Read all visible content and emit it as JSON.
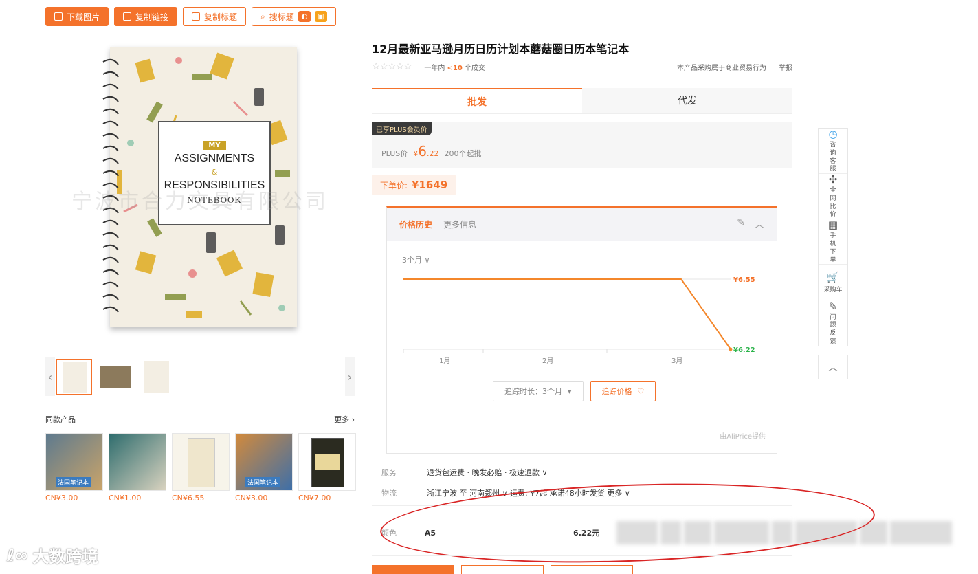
{
  "toolbar": {
    "download_image": "下载图片",
    "copy_link": "复制链接",
    "copy_title": "复制标题",
    "search_title": "搜标题"
  },
  "product": {
    "title": "12月最新亚马逊月历日历计划本蘑菇圈日历本笔记本",
    "stars": "☆☆☆☆☆",
    "sales_prefix": "一年内",
    "sales_count": "<10",
    "sales_suffix": "个成交",
    "trade_notice": "本产品采购属于商业贸易行为",
    "report": "举报",
    "notebook_cover": {
      "my": "MY",
      "line1": "ASSIGNMENTS",
      "amp": "&",
      "line2": "RESPONSIBILITIES",
      "line3": "NOTEBOOK"
    },
    "watermark": "宁波市合力文具有限公司"
  },
  "tabs": {
    "wholesale": "批发",
    "dropship": "代发"
  },
  "plus": {
    "badge": "已享PLUS会员价",
    "label": "PLUS价",
    "currency": "¥",
    "price_int": "6",
    "price_dec": ".22",
    "moq": "200个起批"
  },
  "order_price": {
    "label": "下单价:",
    "value": "¥1649"
  },
  "price_history": {
    "tab_active": "价格历史",
    "tab_more": "更多信息",
    "range": "3个月",
    "track_duration": "追踪时长：3个月",
    "track_price": "追踪价格",
    "provider": "由AliPrice提供"
  },
  "chart_data": {
    "type": "line",
    "x": [
      "1月",
      "2月",
      "3月"
    ],
    "series": [
      {
        "values": [
          6.55,
          6.55,
          6.55,
          6.22
        ]
      }
    ],
    "labels": {
      "high": "¥6.55",
      "low": "¥6.22"
    },
    "colors": {
      "line": "#f4872b",
      "high_label": "#f4722b",
      "low_label": "#2bb34a"
    }
  },
  "service": {
    "label": "服务",
    "value": "退货包运费 · 晚发必赔 · 极速退款 ∨"
  },
  "logistics": {
    "label": "物流",
    "value": "浙江宁波 至 河南郑州 ∨  运费: ¥7起   承诺48小时发货  更多 ∨"
  },
  "variant": {
    "label": "颜色",
    "name": "A5",
    "price": "6.22元"
  },
  "similar": {
    "title": "同款产品",
    "more": "更多",
    "items": [
      {
        "price": "CN¥3.00",
        "img_text": "法国笔记本"
      },
      {
        "price": "CN¥1.00",
        "img_text": ""
      },
      {
        "price": "CN¥6.55",
        "img_text": ""
      },
      {
        "price": "CN¥3.00",
        "img_text": "法国笔记本"
      },
      {
        "price": "CN¥7.00",
        "img_text": ""
      }
    ]
  },
  "sidebar": {
    "items": [
      {
        "icon": "clock-icon",
        "glyph": "◷",
        "label": "咨询客服"
      },
      {
        "icon": "puzzle-icon",
        "glyph": "✣",
        "label": "全网比价"
      },
      {
        "icon": "qrcode-icon",
        "glyph": "▦",
        "label": "手机下单"
      },
      {
        "icon": "cart-icon",
        "glyph": "🛒",
        "label": "采购车"
      },
      {
        "icon": "edit-icon",
        "glyph": "✎",
        "label": "问题反馈"
      }
    ],
    "up": "︿"
  },
  "brand_watermark": "大数跨境",
  "colors": {
    "accent": "#f4722b",
    "plus_gold": "#f0d6a4",
    "annotation_red": "#d92525"
  }
}
